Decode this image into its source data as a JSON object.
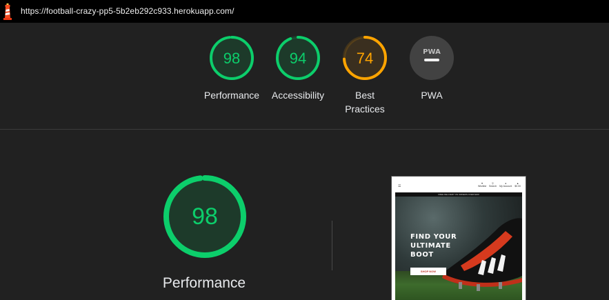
{
  "topbar": {
    "url": "https://football-crazy-pp5-5b2eb292c933.herokuapp.com/",
    "logo_icon": "lighthouse-icon"
  },
  "gauges": [
    {
      "score": "98",
      "label": "Performance",
      "value": 98,
      "color": "#0cce6b"
    },
    {
      "score": "94",
      "label": "Accessibility",
      "value": 94,
      "color": "#0cce6b"
    },
    {
      "score": "74",
      "label": "Best Practices",
      "value": 74,
      "color": "#ffa400"
    },
    {
      "score": "PWA",
      "label": "PWA",
      "value": null,
      "color": "#9e9e9e"
    }
  ],
  "main": {
    "score": "98",
    "value": 98,
    "label": "Performance",
    "color": "#0cce6b"
  },
  "thumbnail": {
    "menu_icon": "hamburger-icon",
    "nav_items": [
      "Wishlist",
      "Search",
      "My Account",
      "$0.00"
    ],
    "promo": "FREE DELIVERY ON ORDERS OVER $100",
    "hero_title_lines": [
      "FIND YOUR",
      "ULTIMATE",
      "BOOT"
    ],
    "hero_button": "SHOP NOW"
  },
  "colors": {
    "pass": "#0cce6b",
    "average": "#ffa400",
    "background": "#212121"
  }
}
